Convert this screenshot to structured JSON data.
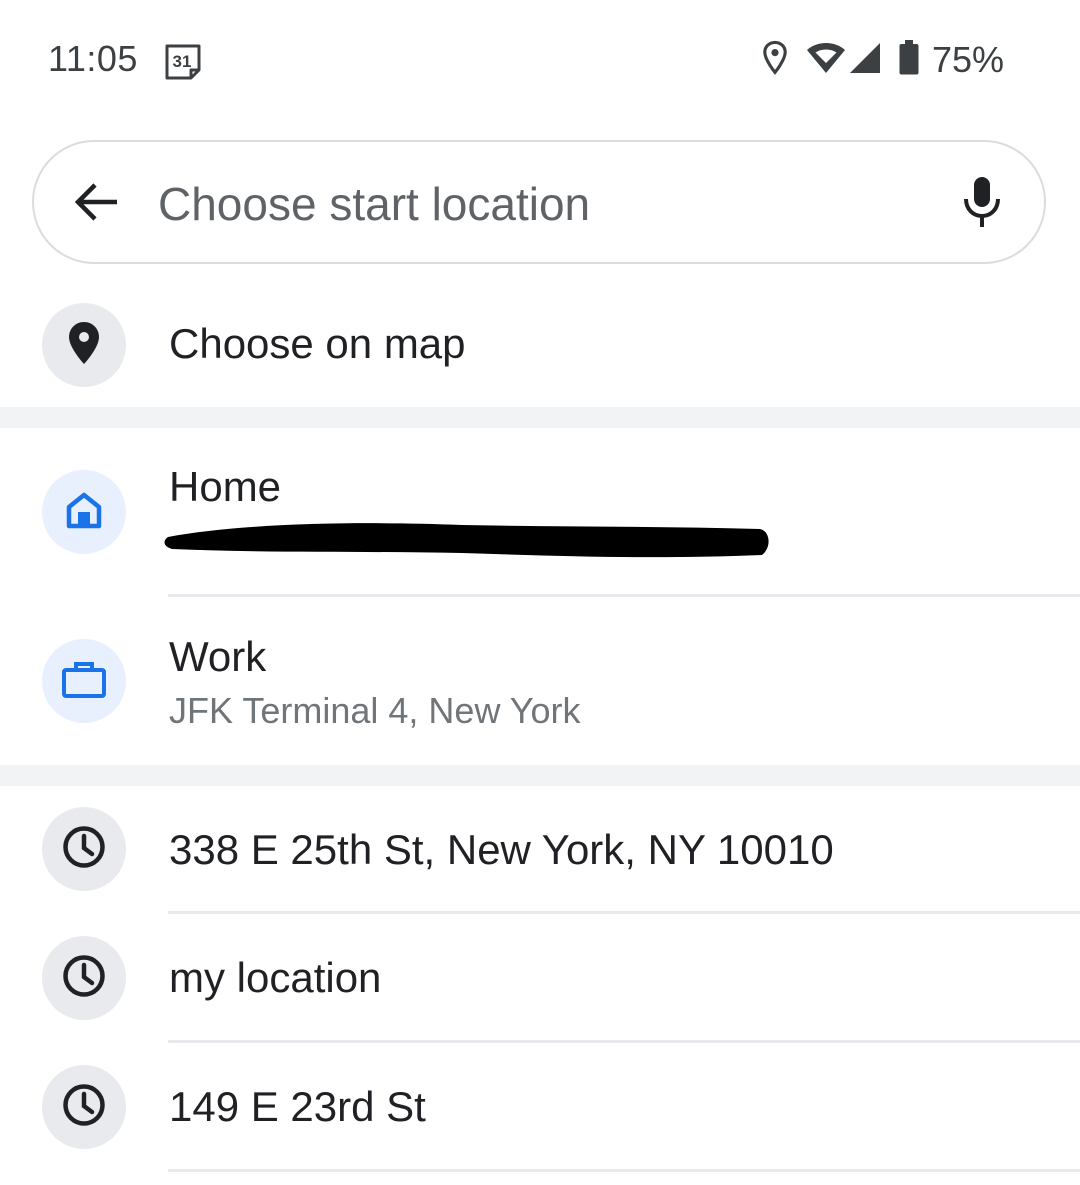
{
  "status_bar": {
    "time": "11:05",
    "calendar_day": "31",
    "battery_percent": "75%",
    "icons": [
      "calendar-icon",
      "location-icon",
      "wifi-icon",
      "signal-icon",
      "battery-icon"
    ]
  },
  "search": {
    "placeholder": "Choose start location",
    "value": "",
    "back_icon": "arrow-back-icon",
    "mic_icon": "microphone-icon"
  },
  "choose_on_map": {
    "label": "Choose on map",
    "icon": "map-pin-icon"
  },
  "saved_places": [
    {
      "title": "Home",
      "subtitle": "",
      "icon": "home-icon",
      "subtitle_redacted": true
    },
    {
      "title": "Work",
      "subtitle": "JFK Terminal 4, New York",
      "icon": "briefcase-icon"
    }
  ],
  "recent": [
    {
      "title": "338 E 25th St, New York, NY 10010",
      "icon": "history-clock-icon"
    },
    {
      "title": "my location",
      "icon": "history-clock-icon"
    },
    {
      "title": "149 E 23rd St",
      "icon": "history-clock-icon"
    }
  ],
  "colors": {
    "accent_blue": "#1a73e8",
    "icon_grey_bg": "#e8eaed",
    "icon_blue_bg": "#e8f0fe",
    "text_primary": "#202124",
    "text_secondary": "#70757a"
  }
}
